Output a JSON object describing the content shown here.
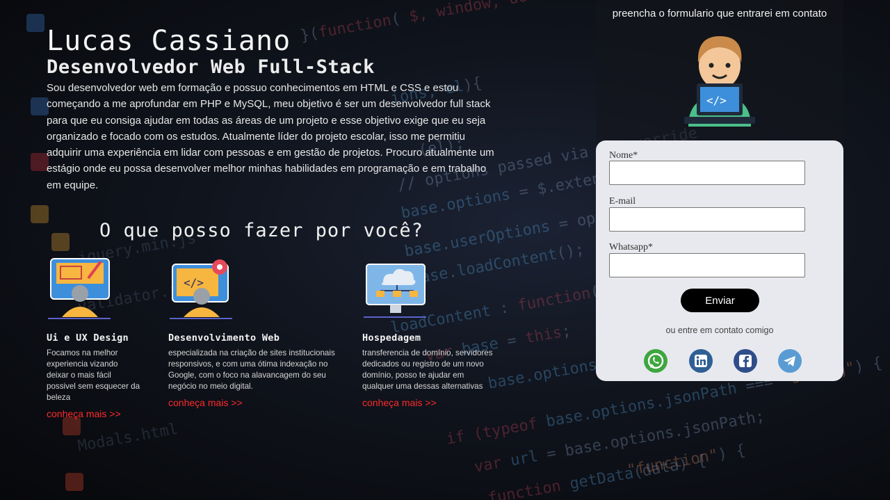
{
  "hero": {
    "name": "Lucas Cassiano",
    "role": "Desenvolvedor Web Full-Stack",
    "bio": "Sou desenvolvedor web em formação e possuo conhecimentos em HTML e CSS e estou começando a me aprofundar em PHP e MySQL, meu objetivo é ser um desenvolvedor full stack para que eu consiga ajudar em todas as áreas de um projeto e esse objetivo exige que eu seja organizado e focado com os estudos. Atualmente líder do projeto escolar, isso me permitiu adquirir uma experiência em lidar com pessoas e em gestão de projetos. Procuro atualmente um estágio onde eu possa desenvolver melhor minhas habilidades em programação e em trabalho em equipe."
  },
  "services": {
    "title": "O que posso fazer por você?",
    "items": [
      {
        "icon": "ui-design-icon",
        "title": "Ui e UX Design",
        "description": "Focamos na melhor experiencia vizando deixar o mais fácil possivel sem esquecer da beleza",
        "link": "conheça mais >>"
      },
      {
        "icon": "web-dev-icon",
        "title": "Desenvolvimento Web",
        "description": "especializada na criação de sites institucionais responsivos, e com uma ótima indexação no Google, com o foco na alavancagem do seu negócio no meio digital.",
        "link": "conheça mais >>"
      },
      {
        "icon": "cloud-hosting-icon",
        "title": "Hospedagem",
        "description": "transferencia de domínio, servidores dedicados ou registro de um novo domínio, posso te ajudar em qualquer uma dessas alternativas",
        "link": "conheça mais >>"
      }
    ]
  },
  "contact": {
    "hint": "preencha o formulario que entrarei em contato",
    "avatar_icon": "developer-avatar-icon",
    "fields": {
      "name_label": "Nome*",
      "name_value": "",
      "email_label": "E-mail",
      "email_value": "",
      "whatsapp_label": "Whatsapp*",
      "whatsapp_value": ""
    },
    "submit_label": "Enviar",
    "alt_text": "ou entre em contato comigo",
    "socials": [
      {
        "icon": "whatsapp-icon",
        "color": "#3fa63f"
      },
      {
        "icon": "linkedin-icon",
        "color": "#2f5f95"
      },
      {
        "icon": "facebook-icon",
        "color": "#2f4d8a"
      },
      {
        "icon": "telegram-icon",
        "color": "#5a9bd3"
      }
    ]
  },
  "colors": {
    "accent_link": "#ff2a2a",
    "card_bg": "#e7e9ee",
    "button_bg": "#000000"
  }
}
